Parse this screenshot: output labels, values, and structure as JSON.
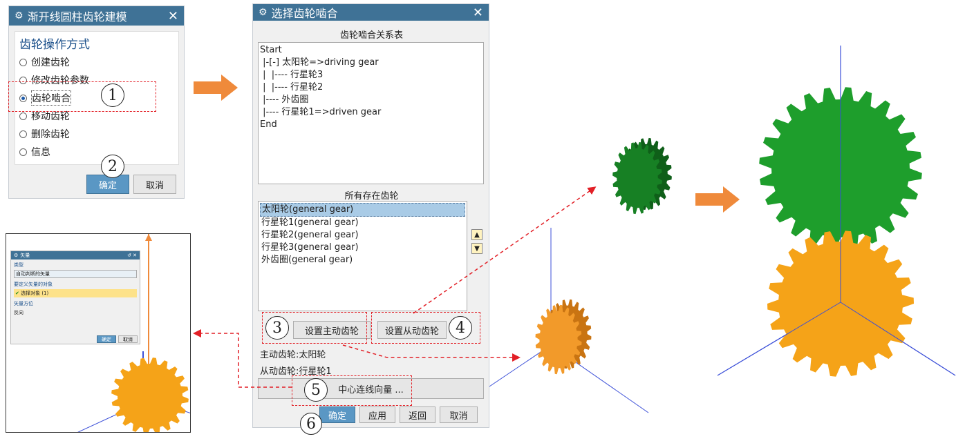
{
  "dialog1": {
    "title": "渐开线圆柱齿轮建模",
    "section_title": "齿轮操作方式",
    "options": [
      "创建齿轮",
      "修改齿轮参数",
      "齿轮啮合",
      "移动齿轮",
      "删除齿轮",
      "信息"
    ],
    "selected_index": 2,
    "ok": "确定",
    "cancel": "取消"
  },
  "dialog2": {
    "title": "选择齿轮啮合",
    "relation_label": "齿轮啮合关系表",
    "relation_lines": [
      "Start",
      " |-[-] 太阳轮=>driving gear",
      " |  |---- 行星轮3",
      " |  |---- 行星轮2",
      " |---- 外齿圈",
      " |---- 行星轮1=>driven gear",
      "End"
    ],
    "gears_label": "所有存在齿轮",
    "gears": [
      "太阳轮(general gear)",
      "行星轮1(general gear)",
      "行星轮2(general gear)",
      "行星轮3(general gear)",
      "外齿圈(general gear)"
    ],
    "selected_gear": 0,
    "set_driving": "设置主动齿轮",
    "set_driven": "设置从动齿轮",
    "driving_text": "主动齿轮:太阳轮",
    "driven_text": "从动齿轮:行星轮1",
    "center_vector": "中心连线向量 ...",
    "ok": "确定",
    "apply": "应用",
    "back": "返回",
    "cancel": "取消"
  },
  "vector_dialog": {
    "title": "矢量",
    "type_label": "类型",
    "type_value": "自动判断的矢量",
    "object_label": "要定义矢量的对象",
    "object_value": "选择对象 (1)",
    "orient_label": "矢量方位",
    "reverse": "反向",
    "ok": "确定",
    "cancel": "取消"
  },
  "step_numbers": [
    "1",
    "2",
    "3",
    "4",
    "5",
    "6"
  ],
  "colors": {
    "titlebar": "#3f7296",
    "green_gear": "#1e9e2c",
    "orange_gear": "#f5a318",
    "red_dash": "#e21f26",
    "arrow_orange": "#ef8a3b",
    "axis_blue": "#3b4fd8"
  }
}
